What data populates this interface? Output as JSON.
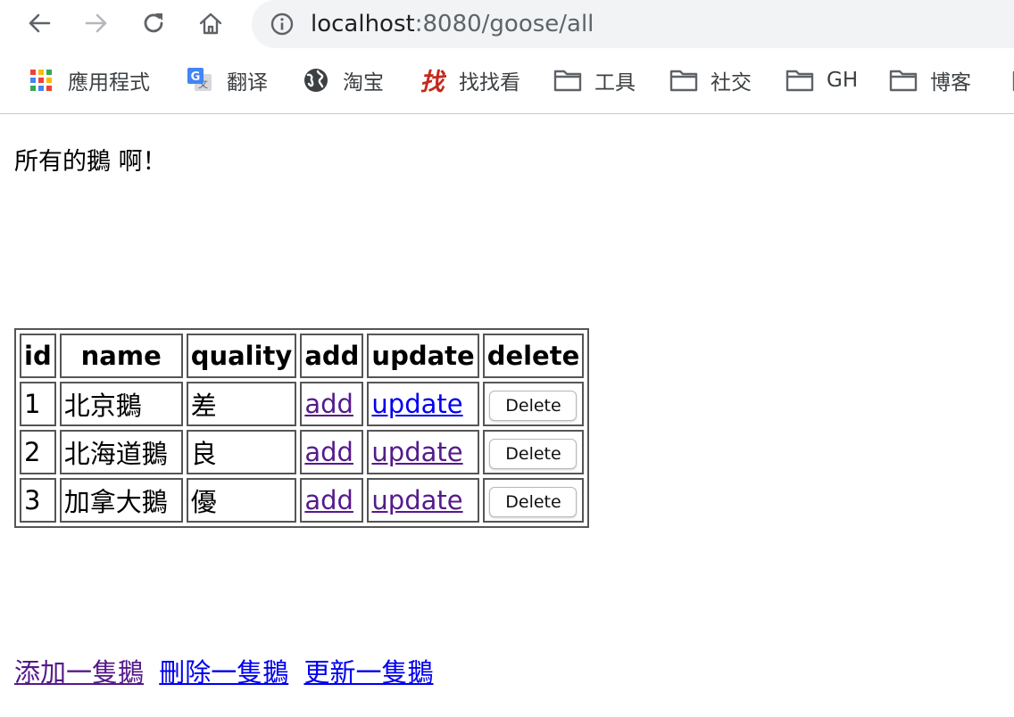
{
  "browser": {
    "url_host": "localhost",
    "url_rest": ":8080/goose/all",
    "bookmarks": [
      {
        "label": "應用程式",
        "icon": "apps-grid-icon"
      },
      {
        "label": "翻译",
        "icon": "google-translate-icon"
      },
      {
        "label": "淘宝",
        "icon": "globe-icon"
      },
      {
        "label": "找找看",
        "icon": "zhao-icon"
      },
      {
        "label": "工具",
        "icon": "folder-icon"
      },
      {
        "label": "社交",
        "icon": "folder-icon"
      },
      {
        "label": "GH",
        "icon": "folder-icon"
      },
      {
        "label": "博客",
        "icon": "folder-icon"
      }
    ]
  },
  "page": {
    "heading": "所有的鵝 啊！",
    "table": {
      "headers": [
        "id",
        "name",
        "quality",
        "add",
        "update",
        "delete"
      ],
      "rows": [
        {
          "id": "1",
          "name": "北京鵝",
          "quality": "差",
          "add": "add",
          "update": "update",
          "delete": "Delete"
        },
        {
          "id": "2",
          "name": "北海道鵝",
          "quality": "良",
          "add": "add",
          "update": "update",
          "delete": "Delete"
        },
        {
          "id": "3",
          "name": "加拿大鵝",
          "quality": "優",
          "add": "add",
          "update": "update",
          "delete": "Delete"
        }
      ]
    },
    "footer_links": [
      "添加一隻鵝",
      "刪除一隻鵝",
      "更新一隻鵝"
    ]
  },
  "colors": {
    "link": "#0000ee",
    "visited_link": "#551a8b",
    "omnibox_bg": "#f1f3f4",
    "zhao_icon": "#c5291c"
  }
}
